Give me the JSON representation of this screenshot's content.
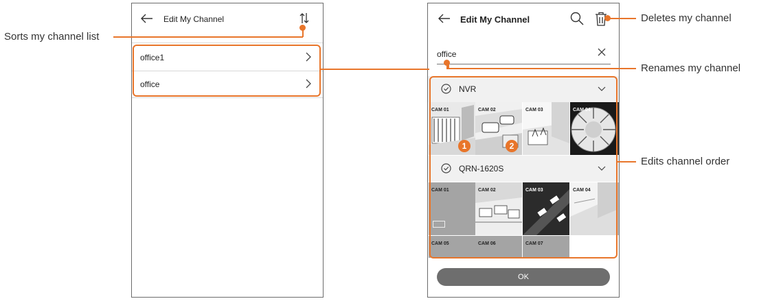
{
  "left_screen": {
    "title": "Edit My Channel",
    "items": [
      {
        "label": "office1"
      },
      {
        "label": "office"
      }
    ]
  },
  "right_screen": {
    "title": "Edit My Channel",
    "name_input": {
      "value": "office"
    },
    "groups": [
      {
        "name": "NVR",
        "cameras": [
          "CAM 01",
          "CAM 02",
          "CAM 03",
          "CAM 04"
        ]
      },
      {
        "name": "QRN-1620S",
        "cameras": [
          "CAM 01",
          "CAM 02",
          "CAM 03",
          "CAM 04",
          "CAM 05",
          "CAM 06",
          "CAM 07"
        ]
      }
    ],
    "badges": [
      "1",
      "2"
    ],
    "ok_label": "OK"
  },
  "callouts": {
    "sort": "Sorts my channel list",
    "delete": "Deletes my channel",
    "rename": "Renames my channel",
    "order": "Edits channel order"
  },
  "colors": {
    "accent": "#e8752a",
    "frame": "#6b6b6b",
    "button": "#6e6e6e"
  },
  "icons": [
    "back-arrow-icon",
    "sort-icon",
    "chevron-right-icon",
    "search-icon",
    "trash-icon",
    "close-icon",
    "check-circle-icon",
    "chevron-down-icon"
  ]
}
